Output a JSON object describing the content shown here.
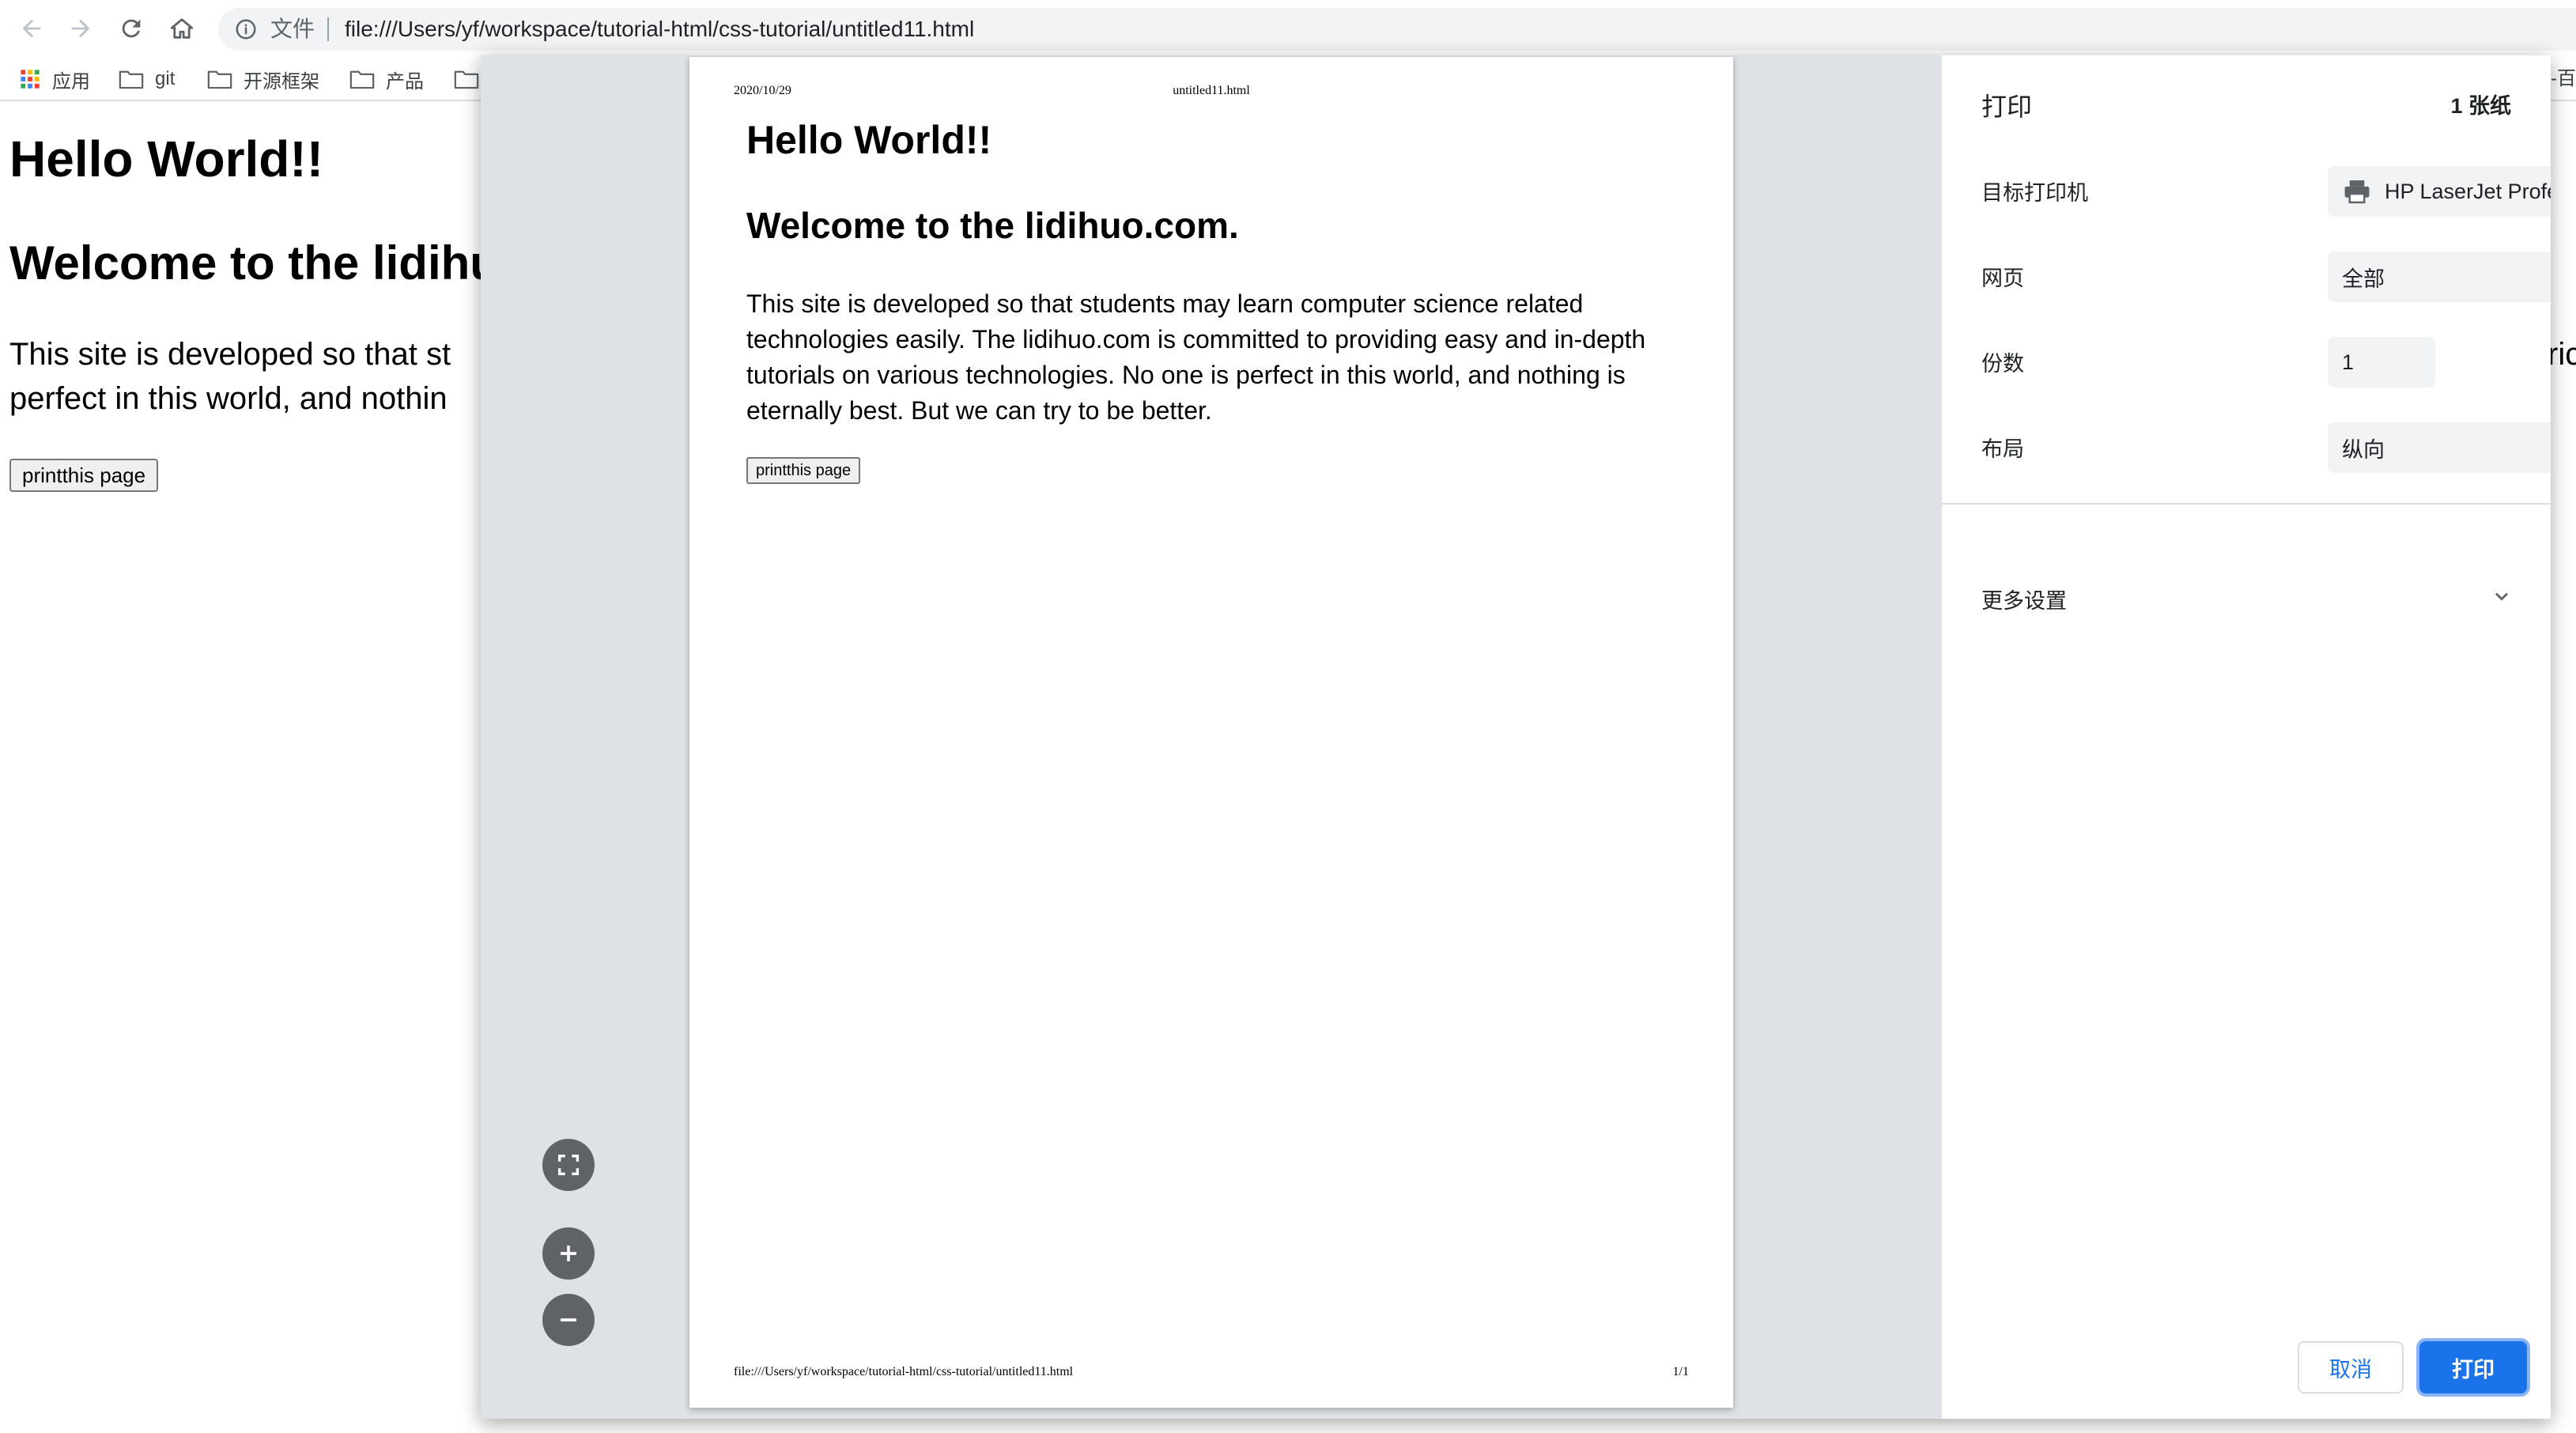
{
  "browser": {
    "back_icon": "arrow-left-icon",
    "forward_icon": "arrow-right-icon",
    "reload_icon": "reload-icon",
    "home_icon": "home-icon",
    "scheme_label": "文件",
    "url": "file:///Users/yf/workspace/tutorial-html/css-tutorial/untitled11.html"
  },
  "bookmarks": {
    "items": [
      {
        "label": "应用",
        "icon": "apps-grid-icon"
      },
      {
        "label": "git",
        "icon": "folder-icon"
      },
      {
        "label": "开源框架",
        "icon": "folder-icon"
      },
      {
        "label": "产品",
        "icon": "folder-icon"
      },
      {
        "label": "",
        "icon": "folder-icon"
      }
    ],
    "overflow_text": "-百"
  },
  "page": {
    "heading1": "Hello World!!",
    "heading2": "Welcome to the lidihu",
    "para_line1": "This site is developed so that st",
    "para_line2": "perfect in this world, and nothin",
    "para_right": "ric",
    "button": "printthis page"
  },
  "print_preview": {
    "header_date": "2020/10/29",
    "header_title": "untitled11.html",
    "heading1": "Hello World!!",
    "heading2": "Welcome to the lidihuo.com.",
    "paragraph": "This site is developed so that students may learn computer science related technologies easily. The lidihuo.com is committed to providing easy and in-depth tutorials on various technologies. No one is perfect in this world, and nothing is eternally best. But we can try to be better.",
    "button": "printthis page",
    "footer_url": "file:///Users/yf/workspace/tutorial-html/css-tutorial/untitled11.html",
    "footer_page": "1/1"
  },
  "print_settings": {
    "title": "打印",
    "sheets": "1 张纸",
    "destination_label": "目标打印机",
    "destination_value": "HP LaserJet Professional",
    "pages_label": "网页",
    "pages_value": "全部",
    "copies_label": "份数",
    "copies_value": "1",
    "layout_label": "布局",
    "layout_value": "纵向",
    "more_settings": "更多设置",
    "cancel": "取消",
    "print": "打印"
  },
  "colors": {
    "accent": "#1a73e8",
    "dialog_bg": "#dee1e6",
    "field_bg": "#f1f3f4",
    "zoom_button": "#5f6368"
  }
}
